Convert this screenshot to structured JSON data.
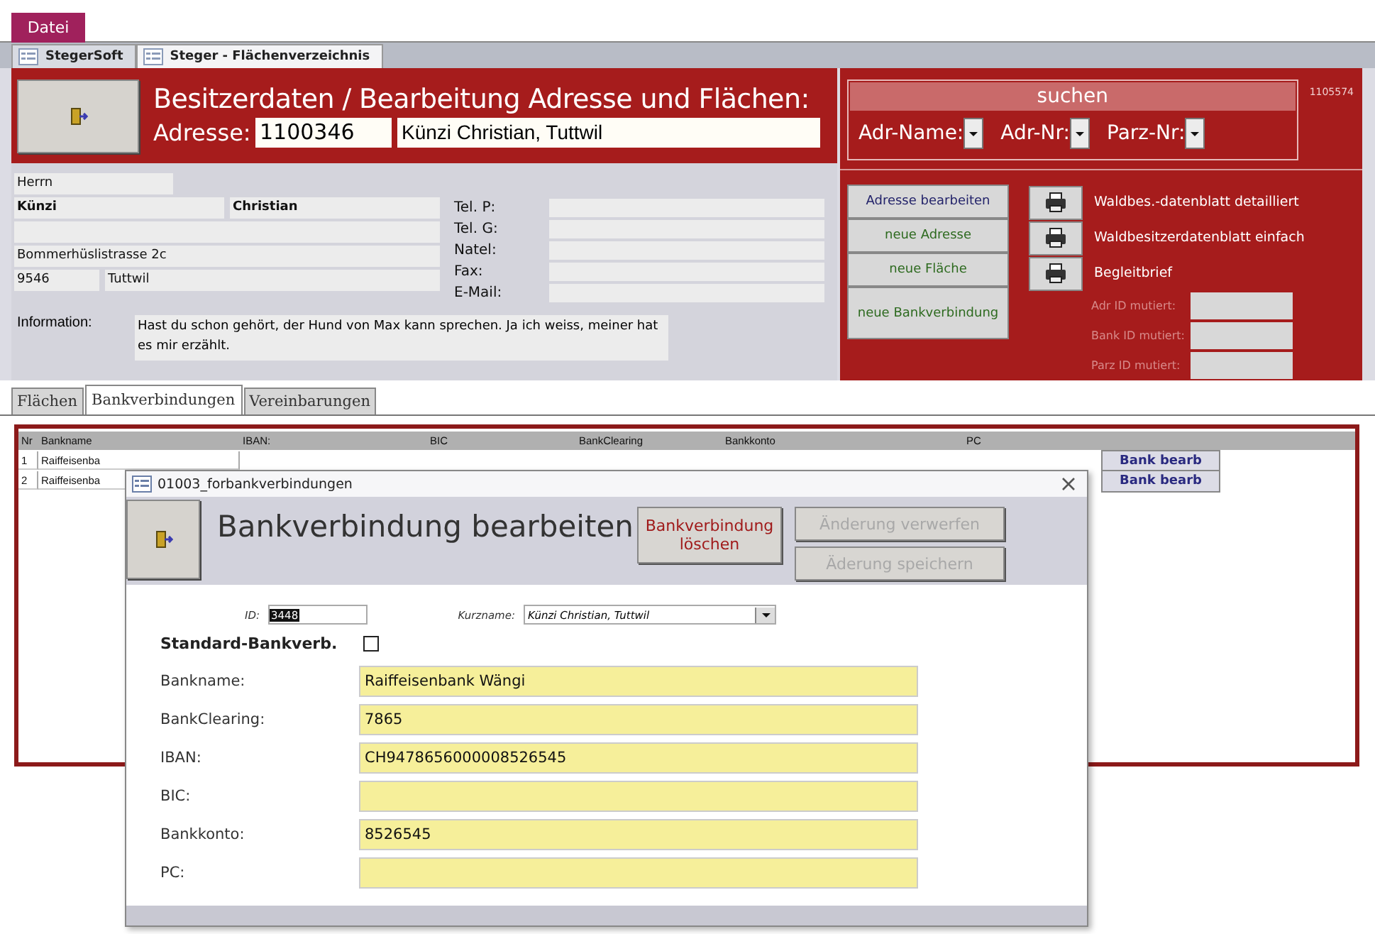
{
  "menu": {
    "file_tab": "Datei"
  },
  "doc_tabs": [
    {
      "label": "StegerSoft",
      "selected": false
    },
    {
      "label": "Steger - Flächenverzeichnis",
      "selected": true
    }
  ],
  "header": {
    "title": "Besitzerdaten / Bearbeitung Adresse und Flächen:",
    "address_label": "Adresse:",
    "address_number": "1100346",
    "address_name": "Künzi Christian, Tuttwil"
  },
  "search": {
    "title": "suchen",
    "fields": [
      "Adr-Name:",
      "Adr-Nr:",
      "Parz-Nr:"
    ],
    "record_id": "1105574"
  },
  "address": {
    "salutation": "Herrn",
    "last_name": "Künzi",
    "first_name": "Christian",
    "street": "Bommerhüslistrasse 2c",
    "zip": "9546",
    "city": "Tuttwil"
  },
  "contacts": [
    "Tel. P:",
    "Tel. G:",
    "Natel:",
    "Fax:",
    "E-Mail:"
  ],
  "information": {
    "label": "Information:",
    "text": "Hast du schon gehört, der Hund von Max kann sprechen. Ja ich weiss, meiner hat es mir erzählt."
  },
  "actions": [
    {
      "label": "Adresse bearbeiten",
      "kind": "edit"
    },
    {
      "label": "neue Adresse",
      "kind": "new"
    },
    {
      "label": "neue Fläche",
      "kind": "new"
    },
    {
      "label": "neue Bankverbindung",
      "kind": "new"
    }
  ],
  "reports": [
    "Waldbes.-datenblatt detailliert",
    "Waldbesitzerdatenblatt einfach",
    "Begleitbrief"
  ],
  "mutation_fields": [
    "Adr ID mutiert:",
    "Bank ID mutiert:",
    "Parz ID mutiert:"
  ],
  "subform_tabs": [
    {
      "label": "Flächen",
      "selected": false
    },
    {
      "label": "Bankverbindungen",
      "selected": true
    },
    {
      "label": "Vereinbarungen",
      "selected": false
    }
  ],
  "bank_table": {
    "columns": [
      "Nr",
      "Bankname",
      "IBAN:",
      "BIC",
      "BankClearing",
      "Bankkonto",
      "PC"
    ],
    "rows": [
      {
        "nr": "1",
        "bankname": "Raiffeisenba",
        "button": "Bank bearb"
      },
      {
        "nr": "2",
        "bankname": "Raiffeisenba",
        "button": "Bank bearb"
      }
    ]
  },
  "dialog": {
    "title": "01003_forbankverbindungen",
    "heading": "Bankverbindung bearbeiten",
    "buttons": [
      {
        "label": "Bankverbindung löschen",
        "disabled": false
      },
      {
        "label": "Änderung verwerfen",
        "disabled": true
      },
      {
        "label": "Äderung speichern",
        "disabled": true
      }
    ],
    "id_label": "ID:",
    "id_value": "3448",
    "short_name_label": "Kurzname:",
    "short_name_value": "Künzi Christian, Tuttwil",
    "standard_label": "Standard-Bankverb.",
    "standard_checked": false,
    "fields": [
      {
        "label": "Bankname:",
        "value": "Raiffeisenbank Wängi"
      },
      {
        "label": "BankClearing:",
        "value": "7865"
      },
      {
        "label": "IBAN:",
        "value": "CH9478656000008526545"
      },
      {
        "label": "BIC:"
      },
      {
        "label": "Bankkonto:",
        "value": "8526545"
      },
      {
        "label": "PC:"
      }
    ]
  }
}
